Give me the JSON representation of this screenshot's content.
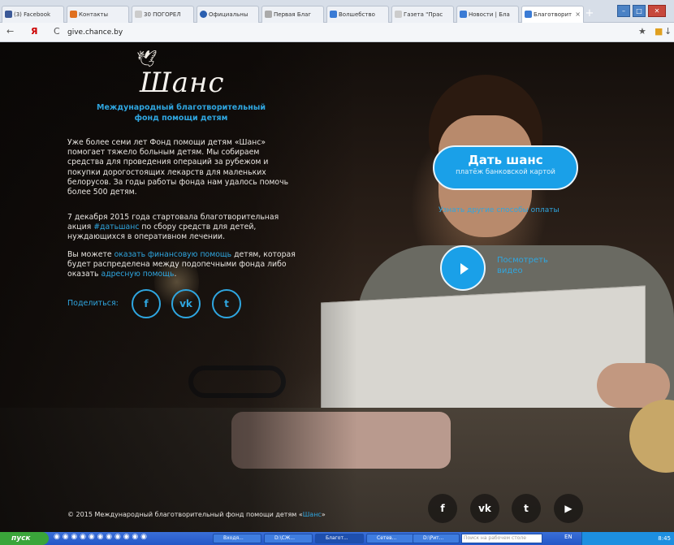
{
  "browser": {
    "tabs": [
      {
        "label": "(3) Facebook",
        "color": "#3b5998"
      },
      {
        "label": "Контакты",
        "color": "#e07020"
      },
      {
        "label": "30 ПОГОРЕЛ",
        "color": "#888888"
      },
      {
        "label": "Официальны",
        "color": "#2a5fb0"
      },
      {
        "label": "Первая Благ",
        "color": "#555555"
      },
      {
        "label": "Волшебство",
        "color": "#3a7bd5"
      },
      {
        "label": "Газета \"Прас",
        "color": "#777777"
      },
      {
        "label": "Новости | Бла",
        "color": "#3a7bd5"
      },
      {
        "label": "Благотворит",
        "color": "#3a7bd5"
      }
    ],
    "url": "give.chance.by",
    "back": "←",
    "yandex": "Я",
    "reload": "C",
    "star": "★",
    "download": "↓",
    "new_tab": "+",
    "win_min": "–",
    "win_max": "□",
    "win_close": "✕"
  },
  "page": {
    "logo": "Шанс",
    "org_name": "Международный благотворительный фонд помощи детям",
    "p1": "Уже более семи лет Фонд помощи детям «Шанс» помогает тяжело больным детям. Мы собираем средства для проведения операций за рубежом и покупки дорогостоящих лекарств для маленьких белорусов. За годы работы фонда нам удалось помочь более 500 детям.",
    "p2_a": "7 декабря 2015 года стартовала благотворительная акция ",
    "p2_link": "#датьшанс",
    "p2_b": " по сбору средств для детей, нуждающихся в оперативном лечении.",
    "p3_a": "Вы можете ",
    "p3_link1": "оказать финансовую помощь",
    "p3_b": " детям, которая будет распределена между подопечными фонда либо оказать ",
    "p3_link2": "адресную помощь",
    "p3_c": ".",
    "share_label": "Поделиться:",
    "share_fb": "f",
    "share_vk": "vk",
    "share_tw": "t",
    "donate_title": "Дать шанс",
    "donate_sub": "платёж банковской картой",
    "other_ways": "Узнать другие способы оплаты",
    "watch_video": "Посмотреть видео",
    "copyright_a": "© 2015 Международный благотворительный фонд помощи детям «",
    "copyright_link": "Шанс",
    "copyright_b": "»",
    "footer_fb": "f",
    "footer_vk": "vk",
    "footer_tw": "t",
    "footer_yt": "▶"
  },
  "taskbar": {
    "start": "пуск",
    "tasks": [
      "Входя...",
      "D:\\СЖ...",
      "Благот...",
      "Сетев...",
      "D:\\Рит..."
    ],
    "search_placeholder": "Поиск на рабочем столе",
    "lang": "EN",
    "time": "8:45"
  }
}
